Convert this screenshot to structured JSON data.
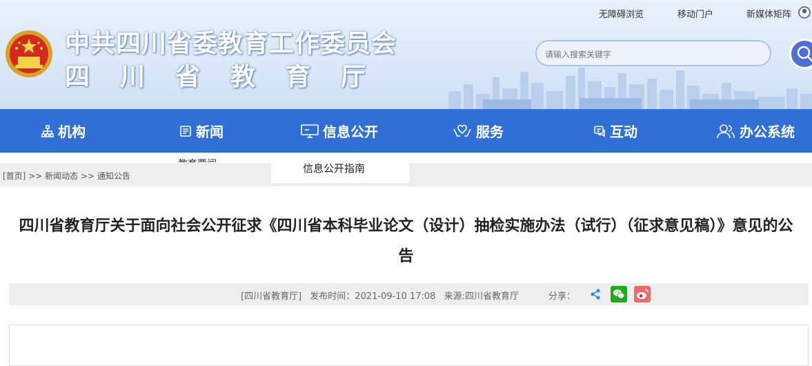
{
  "header": {
    "title_line1": "中共四川省委教育工作委员会",
    "title_line2": "四川省教育厅",
    "top_links": [
      "无障碍浏览",
      "移动门户",
      "新媒体矩阵"
    ],
    "search_placeholder": "请输入搜索关键字"
  },
  "nav": {
    "items": [
      {
        "label": "机构",
        "icon": "org-chart-icon"
      },
      {
        "label": "新闻",
        "icon": "newspaper-icon"
      },
      {
        "label": "信息公开",
        "icon": "monitor-icon"
      },
      {
        "label": "服务",
        "icon": "hands-icon"
      },
      {
        "label": "互动",
        "icon": "chat-icon"
      },
      {
        "label": "办公系统",
        "icon": "users-icon"
      }
    ],
    "dropdown_item": "信息公开指南",
    "ghost_text": "教育要闻"
  },
  "breadcrumb": {
    "home": "[首页]",
    "sep": " >> ",
    "level1": "新闻动态",
    "level2": "通知公告"
  },
  "article": {
    "title": "四川省教育厅关于面向社会公开征求《四川省本科毕业论文（设计）抽检实施办法（试行）（征求意见稿）》意见的公告",
    "source_tag": "[四川省教育厅]",
    "publish_time": "发布时间：2021-09-10 17:08",
    "source": "来源:四川省教育厅",
    "share_label": "分享："
  },
  "colors": {
    "nav_bg": "#2f6fd6",
    "wechat": "#1aad19",
    "weibo": "#e6162d",
    "share": "#2f8de4"
  }
}
